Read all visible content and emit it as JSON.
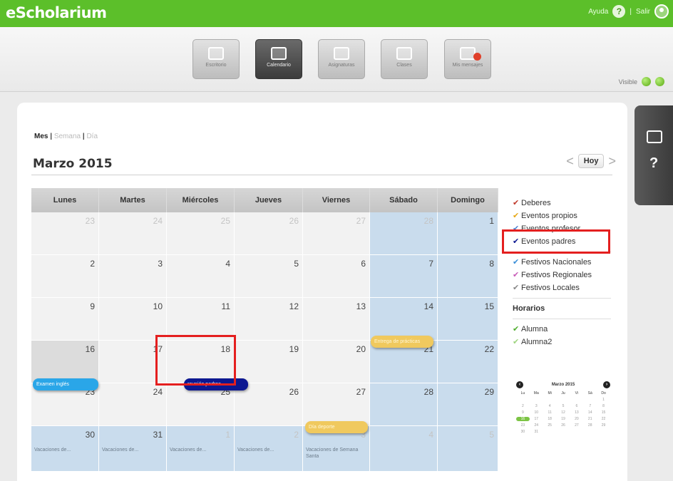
{
  "app": {
    "logo": "eScholarium",
    "help_label": "Ayuda",
    "help_icon": "question-icon",
    "logout_label": "Salir",
    "user_icon": "user-icon"
  },
  "toolbar": {
    "buttons": [
      {
        "label": "Escritorio",
        "icon": "desktop-icon"
      },
      {
        "label": "Calendario",
        "icon": "calendar-icon",
        "active": true
      },
      {
        "label": "Asignaturas",
        "icon": "books-icon"
      },
      {
        "label": "Clases",
        "icon": "class-icon"
      },
      {
        "label": "Mis mensajes",
        "icon": "mail-icon"
      }
    ],
    "visible_label": "Visible"
  },
  "calendar": {
    "view_modes": {
      "month": "Mes",
      "week": "Semana",
      "day": "Día",
      "sep": "|"
    },
    "title": "Marzo 2015",
    "today_label": "Hoy",
    "prev": "<",
    "next": ">",
    "headers": [
      "Lunes",
      "Martes",
      "Miércoles",
      "Jueves",
      "Viernes",
      "Sábado",
      "Domingo"
    ],
    "weeks": [
      [
        "23",
        "24",
        "25",
        "26",
        "27",
        "28",
        "1"
      ],
      [
        "2",
        "3",
        "4",
        "5",
        "6",
        "7",
        "8"
      ],
      [
        "9",
        "10",
        "11",
        "12",
        "13",
        "14",
        "15"
      ],
      [
        "16",
        "17",
        "18",
        "19",
        "20",
        "21",
        "22"
      ],
      [
        "23",
        "24",
        "25",
        "26",
        "27",
        "28",
        "29"
      ],
      [
        "30",
        "31",
        "1",
        "2",
        "3",
        "4",
        "5"
      ]
    ],
    "vacation_notes": [
      "Vacaciones de...",
      "Vacaciones de...",
      "Vacaciones de...",
      "Vacaciones de...",
      "Vacaciones de Semana Santa"
    ],
    "events": {
      "fri13": "Entrega de prácticas",
      "mon16": "Examen inglés",
      "wed18": "reunión padres",
      "fri27": "Día deporte"
    }
  },
  "legend": {
    "groupA": [
      "Deberes",
      "Eventos propios",
      "Eventos profesor",
      "Eventos padres"
    ],
    "groupB": [
      "Festivos Nacionales",
      "Festivos Regionales",
      "Festivos Locales"
    ],
    "horarios_title": "Horarios",
    "horarios": [
      "Alumna",
      "Alumna2"
    ],
    "colors": {
      "deberes": "#c0392b",
      "propios": "#e6a817",
      "profesor": "#4a7fd1",
      "padres": "#0d1891",
      "nacionales": "#3a8fd8",
      "regionales": "#c85bb8",
      "locales": "#888888",
      "alumna": "#4fae2d",
      "alumna2": "#9ed47f"
    }
  },
  "minical": {
    "title": "Marzo 2015",
    "days": [
      "Lu",
      "Ma",
      "Mi",
      "Ju",
      "Vi",
      "Sá",
      "Do"
    ],
    "cells": [
      "",
      "",
      "",
      "",
      "",
      "",
      "1",
      "2",
      "3",
      "4",
      "5",
      "6",
      "7",
      "8",
      "9",
      "10",
      "11",
      "12",
      "13",
      "14",
      "15",
      "16",
      "17",
      "18",
      "19",
      "20",
      "21",
      "22",
      "23",
      "24",
      "25",
      "26",
      "27",
      "28",
      "29",
      "30",
      "31"
    ],
    "selected": "16"
  }
}
